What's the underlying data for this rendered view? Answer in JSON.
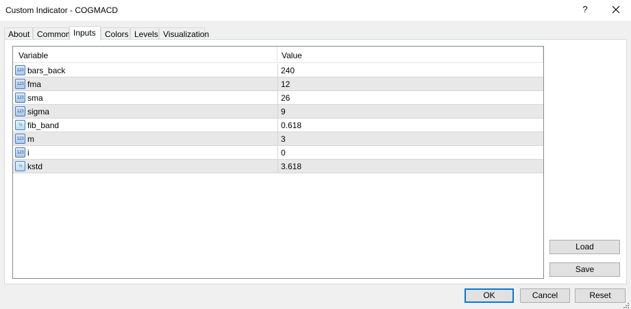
{
  "window": {
    "title": "Custom Indicator - COGMACD",
    "help_label": "?",
    "close_icon": "close-icon"
  },
  "tabs": [
    {
      "label": "About"
    },
    {
      "label": "Common"
    },
    {
      "label": "Inputs",
      "active": true
    },
    {
      "label": "Colors"
    },
    {
      "label": "Levels"
    },
    {
      "label": "Visualization"
    }
  ],
  "grid": {
    "headers": {
      "variable": "Variable",
      "value": "Value"
    },
    "rows": [
      {
        "icon": "123",
        "icon_name": "integer-type-icon",
        "name": "bars_back",
        "value": "240"
      },
      {
        "icon": "123",
        "icon_name": "integer-type-icon",
        "name": "fma",
        "value": "12"
      },
      {
        "icon": "123",
        "icon_name": "integer-type-icon",
        "name": "sma",
        "value": "26"
      },
      {
        "icon": "123",
        "icon_name": "integer-type-icon",
        "name": "sigma",
        "value": "9"
      },
      {
        "icon": "½",
        "icon_name": "double-type-icon",
        "name": "fib_band",
        "value": "0.618"
      },
      {
        "icon": "123",
        "icon_name": "integer-type-icon",
        "name": "m",
        "value": "3"
      },
      {
        "icon": "123",
        "icon_name": "integer-type-icon",
        "name": "i",
        "value": "0"
      },
      {
        "icon": "½",
        "icon_name": "double-type-icon",
        "name": "kstd",
        "value": "3.618"
      }
    ]
  },
  "side_buttons": {
    "load": "Load",
    "save": "Save"
  },
  "footer_buttons": {
    "ok": "OK",
    "cancel": "Cancel",
    "reset": "Reset"
  },
  "colors": {
    "accent": "#0078d7",
    "row_alt": "#e8e8e8"
  }
}
